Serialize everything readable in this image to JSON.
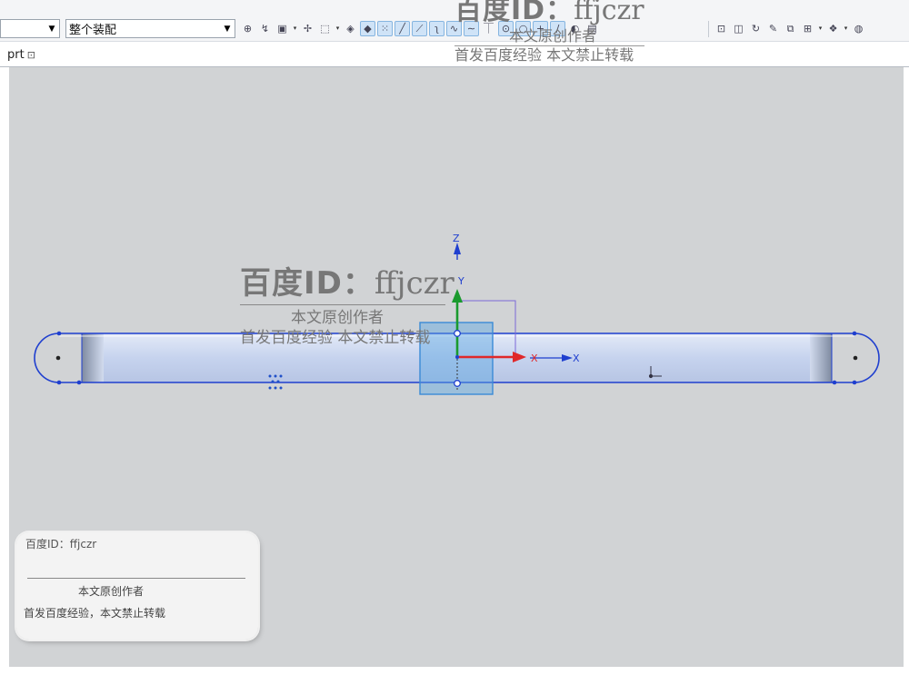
{
  "toolbar": {
    "filter_select": {
      "value": ""
    },
    "assembly_select": {
      "value": "整个装配"
    },
    "icons": [
      {
        "name": "snap-icon",
        "glyph": "⊕"
      },
      {
        "name": "arrange-icon",
        "glyph": "↯"
      },
      {
        "name": "select-box-icon",
        "glyph": "▣"
      },
      {
        "name": "sketch-dropdown-icon",
        "glyph": "▾"
      },
      {
        "name": "point-icon",
        "glyph": "✢"
      },
      {
        "name": "lasso-icon",
        "glyph": "⬚"
      },
      {
        "name": "rect-dropdown-icon",
        "glyph": "▾"
      },
      {
        "name": "body-icon",
        "glyph": "◈"
      },
      {
        "name": "cube-icon",
        "glyph": "◆"
      },
      {
        "name": "dots-icon",
        "glyph": "⁙"
      },
      {
        "name": "line-icon",
        "glyph": "╱"
      },
      {
        "name": "diag-line-icon",
        "glyph": "⟋"
      },
      {
        "name": "curve-icon",
        "glyph": "ʅ"
      },
      {
        "name": "spline-icon",
        "glyph": "∿"
      },
      {
        "name": "wave-icon",
        "glyph": "∼"
      },
      {
        "name": "intersect-icon",
        "glyph": "⏉"
      },
      {
        "name": "circle-center-icon",
        "glyph": "⊙"
      },
      {
        "name": "circle-icon",
        "glyph": "○"
      },
      {
        "name": "plus-icon",
        "glyph": "+"
      },
      {
        "name": "slash-icon",
        "glyph": "∕"
      },
      {
        "name": "surface-icon",
        "glyph": "◐"
      },
      {
        "name": "book-icon",
        "glyph": "▤"
      }
    ],
    "right_icons": [
      {
        "name": "zoom-fit-icon",
        "glyph": "⊡"
      },
      {
        "name": "view-icon",
        "glyph": "◫"
      },
      {
        "name": "rotate-icon",
        "glyph": "↻"
      },
      {
        "name": "paint-icon",
        "glyph": "✎"
      },
      {
        "name": "layer-icon",
        "glyph": "⧉"
      },
      {
        "name": "grid-icon",
        "glyph": "⊞"
      },
      {
        "name": "grid-dropdown-icon",
        "glyph": "▾"
      },
      {
        "name": "render-icon",
        "glyph": "❖"
      },
      {
        "name": "render-dropdown-icon",
        "glyph": "▾"
      },
      {
        "name": "shade-icon",
        "glyph": "◍"
      }
    ]
  },
  "part_tab": {
    "label": "prt",
    "pin": "⊡"
  },
  "csys": {
    "z_label": "Z",
    "x_label": "X",
    "y_label": "Y",
    "x_label2": "X"
  },
  "watermark_top": {
    "main": "百度ID：",
    "id": "ffjczr",
    "line1": "本文原创作者",
    "line2": "首发百度经验   本文禁止转载"
  },
  "watermark_mid": {
    "main": "百度ID：",
    "id": "ffjczr",
    "line1": "本文原创作者",
    "line2": "首发百度经验   本文禁止转载"
  },
  "watermark_corner": {
    "main": "百度ID：",
    "id": "ffjczr",
    "line1": "本文原创作者",
    "line2": "首发百度经验，本文禁止转载"
  },
  "colors": {
    "viewport_bg": "#d1d3d5",
    "part_fill": "#c9d6ef",
    "edge": "#1f3fcf",
    "x_axis": "#e0282a",
    "z_axis": "#1a9a2e",
    "handle_fill": "#5aa6e3"
  }
}
